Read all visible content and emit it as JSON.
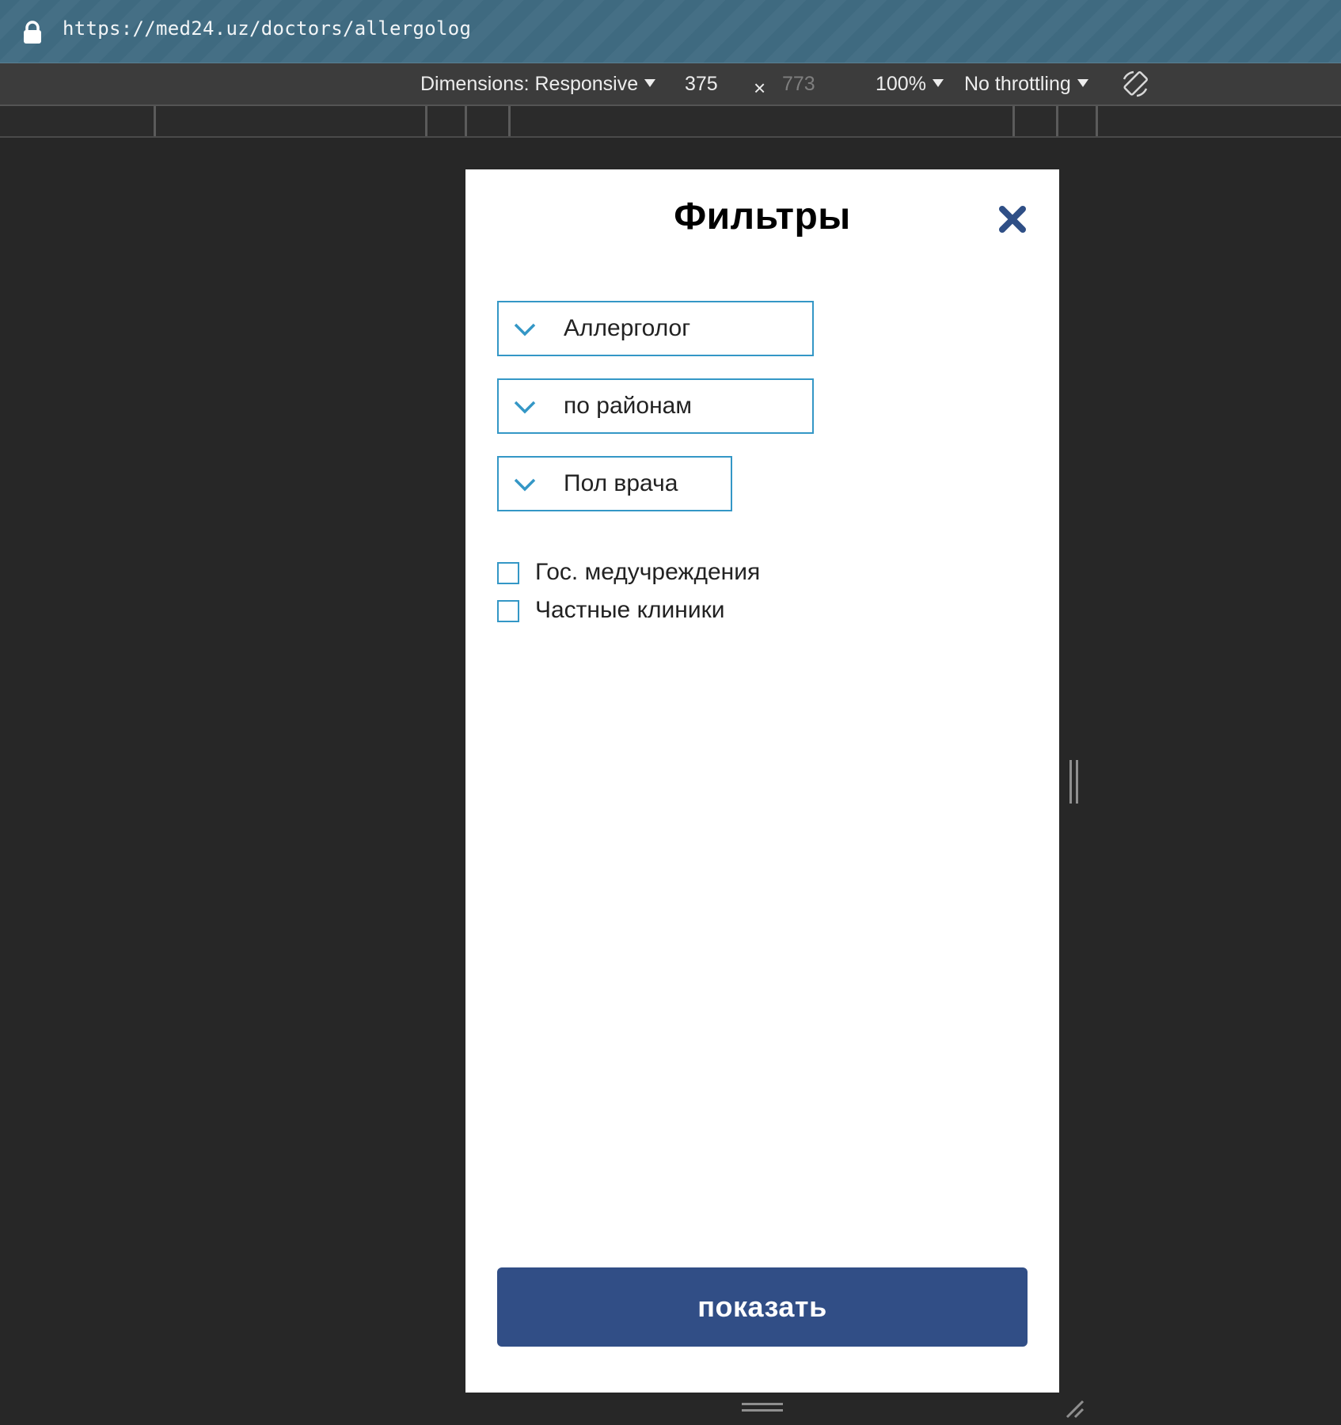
{
  "browser": {
    "url": "https://med24.uz/doctors/allergolog"
  },
  "device_toolbar": {
    "dimensions_label": "Dimensions: Responsive",
    "width": "375",
    "times": "×",
    "height": "773",
    "zoom": "100%",
    "throttling": "No throttling"
  },
  "filters": {
    "title": "Фильтры",
    "selects": [
      {
        "label": "Аллерголог"
      },
      {
        "label": "по районам"
      },
      {
        "label": "Пол врача"
      }
    ],
    "checkboxes": [
      {
        "label": "Гос. медучреждения",
        "checked": false
      },
      {
        "label": "Частные клиники",
        "checked": false
      }
    ],
    "submit_label": "показать"
  },
  "colors": {
    "accent_border": "#3497c6",
    "button_bg": "#314e86",
    "close_icon": "#2f4f86"
  }
}
